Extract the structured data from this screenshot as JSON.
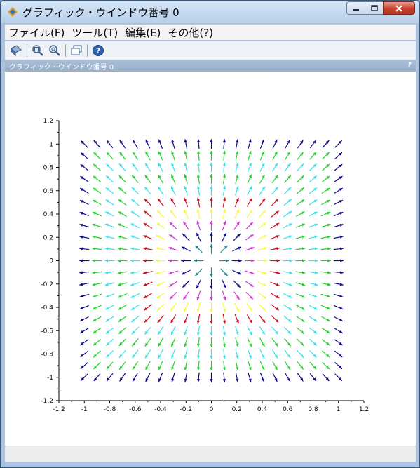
{
  "window": {
    "title": "グラフィック・ウインドウ番号 0"
  },
  "menu": [
    {
      "label": "ファイル(F)"
    },
    {
      "label": "ツール(T)"
    },
    {
      "label": "編集(E)"
    },
    {
      "label": "その他(?)"
    }
  ],
  "toolbar": {
    "icons": [
      "rotate-icon",
      "zoom-icon",
      "unzoom-icon",
      "datatip-icon",
      "help-icon"
    ]
  },
  "panel": {
    "title": "グラフィック・ウインドウ番号 0",
    "help": "?"
  },
  "chart_data": {
    "type": "quiver",
    "title": "",
    "xlabel": "",
    "ylabel": "",
    "xlim": [
      -1.2,
      1.2
    ],
    "ylim": [
      -1.2,
      1.2
    ],
    "xticks": [
      "-1.2",
      "-1",
      "-0.8",
      "-0.6",
      "-0.4",
      "-0.2",
      "0",
      "0.2",
      "0.4",
      "0.6",
      "0.8",
      "1",
      "1.2"
    ],
    "yticks": [
      "1.2",
      "1",
      "0.8",
      "0.6",
      "0.4",
      "0.2",
      "0",
      "-0.2",
      "-0.4",
      "-0.6",
      "-0.8",
      "-1",
      "-1.2"
    ],
    "field": "radial outward (x, y) / r",
    "grid": {
      "x_from": -1.0,
      "x_to": 1.0,
      "y_from": -1.0,
      "y_to": 1.0,
      "step": 0.1
    },
    "colors": [
      "#0a0a8c",
      "#22d12a",
      "#37e0e8",
      "#d0101a",
      "#f7f73a",
      "#d238d6",
      "#1a8a8a",
      "#ffd0d0"
    ]
  }
}
